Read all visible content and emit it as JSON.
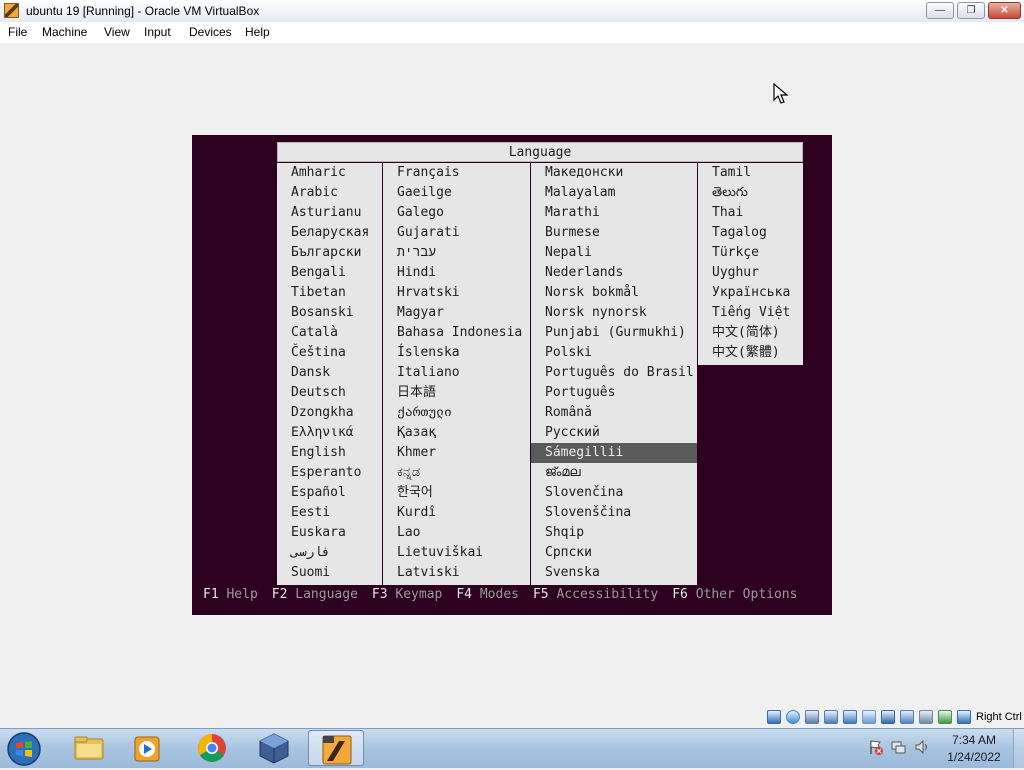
{
  "window": {
    "title": "ubuntu 19 [Running] - Oracle VM VirtualBox",
    "min_symbol": "—",
    "max_symbol": "❐",
    "close_symbol": "✕"
  },
  "menubar": [
    "File",
    "Machine",
    "View",
    "Input",
    "Devices",
    "Help"
  ],
  "language_menu": {
    "title": "Language",
    "columns": [
      [
        "Amharic",
        "Arabic",
        "Asturianu",
        "Беларуская",
        "Български",
        "Bengali",
        "Tibetan",
        "Bosanski",
        "Català",
        "Čeština",
        "Dansk",
        "Deutsch",
        "Dzongkha",
        "Ελληνικά",
        "English",
        "Esperanto",
        "Español",
        "Eesti",
        "Euskara",
        "فارسی",
        "Suomi"
      ],
      [
        "Français",
        "Gaeilge",
        "Galego",
        "Gujarati",
        "עברית",
        "Hindi",
        "Hrvatski",
        "Magyar",
        "Bahasa Indonesia",
        "Íslenska",
        "Italiano",
        "日本語",
        "ქართული",
        "Қазақ",
        "Khmer",
        "ಕನ್ನಡ",
        "한국어",
        "Kurdî",
        "Lao",
        "Lietuviškai",
        "Latviski"
      ],
      [
        "Македонски",
        "Malayalam",
        "Marathi",
        "Burmese",
        "Nepali",
        "Nederlands",
        "Norsk bokmål",
        "Norsk nynorsk",
        "Punjabi (Gurmukhi)",
        "Polski",
        "Português do Brasil",
        "Português",
        "Română",
        "Русский",
        "Sámegillii",
        "ജ്ംമല",
        "Slovenčina",
        "Slovenščina",
        "Shqip",
        "Српски",
        "Svenska"
      ],
      [
        "Tamil",
        "తెలుగు",
        "Thai",
        "Tagalog",
        "Türkçe",
        "Uyghur",
        "Українська",
        "Tiếng Việt",
        "中文(简体)",
        "中文(繁體)"
      ]
    ],
    "selected": "Sámegillii"
  },
  "function_keys": [
    {
      "key": "F1",
      "label": "Help"
    },
    {
      "key": "F2",
      "label": "Language"
    },
    {
      "key": "F3",
      "label": "Keymap"
    },
    {
      "key": "F4",
      "label": "Modes"
    },
    {
      "key": "F5",
      "label": "Accessibility"
    },
    {
      "key": "F6",
      "label": "Other Options"
    }
  ],
  "statusbar": {
    "icons": [
      "hard-disk-icon",
      "optical-disk-icon",
      "audio-icon",
      "network-icon",
      "usb-icon",
      "shared-folder-icon",
      "display-icon",
      "video-capture-icon",
      "virtualization-icon",
      "mouse-integration-icon",
      "keyboard-capture-icon"
    ],
    "host_key": "Right Ctrl"
  },
  "taskbar": {
    "apps": [
      "start-orb-icon",
      "file-explorer-icon",
      "media-player-icon",
      "chrome-icon",
      "virtualbox-icon",
      "virtualbox-vm-icon"
    ],
    "time": "7:34 AM",
    "date": "1/24/2022"
  },
  "colors": {
    "guest_bg": "#2c001e",
    "menu_bg": "#e6e6e6",
    "selected_bg": "#5a5a5a"
  }
}
